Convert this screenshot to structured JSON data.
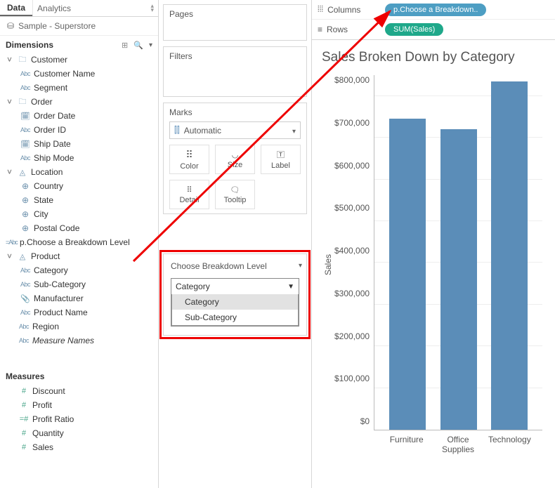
{
  "data_header": {
    "tab_data": "Data",
    "tab_analytics": "Analytics"
  },
  "datasource": "Sample - Superstore",
  "dimensions_header": "Dimensions",
  "measures_header": "Measures",
  "tree": {
    "customer": "Customer",
    "customer_name": "Customer Name",
    "segment": "Segment",
    "order": "Order",
    "order_date": "Order Date",
    "order_id": "Order ID",
    "ship_date": "Ship Date",
    "ship_mode": "Ship Mode",
    "location": "Location",
    "country": "Country",
    "state": "State",
    "city": "City",
    "postal_code": "Postal Code",
    "param_calc": "p.Choose a Breakdown Level",
    "product": "Product",
    "category": "Category",
    "sub_category": "Sub-Category",
    "manufacturer": "Manufacturer",
    "product_name": "Product Name",
    "region": "Region",
    "measure_names": "Measure Names"
  },
  "measures": {
    "discount": "Discount",
    "profit": "Profit",
    "profit_ratio": "Profit Ratio",
    "quantity": "Quantity",
    "sales": "Sales"
  },
  "cards": {
    "pages": "Pages",
    "filters": "Filters",
    "marks": "Marks",
    "mark_type": "Automatic",
    "color": "Color",
    "size": "Size",
    "label": "Label",
    "detail": "Detail",
    "tooltip": "Tooltip"
  },
  "param": {
    "title": "Choose Breakdown Level",
    "selected": "Category",
    "opt1": "Category",
    "opt2": "Sub-Category"
  },
  "shelves": {
    "columns": "Columns",
    "rows": "Rows",
    "col_pill": "p.Choose a Breakdown..",
    "row_pill": "SUM(Sales)"
  },
  "viz_title": "Sales Broken Down by Category",
  "axis_y_label": "Sales",
  "y_ticks": {
    "t0": "$800,000",
    "t1": "$700,000",
    "t2": "$600,000",
    "t3": "$500,000",
    "t4": "$400,000",
    "t5": "$300,000",
    "t6": "$200,000",
    "t7": "$100,000",
    "t8": "$0"
  },
  "x_ticks": {
    "c0": "Furniture",
    "c1": "Office Supplies",
    "c2": "Technology"
  },
  "chart_data": {
    "type": "bar",
    "title": "Sales Broken Down by Category",
    "xlabel": "",
    "ylabel": "Sales",
    "ylim": [
      0,
      850000
    ],
    "categories": [
      "Furniture",
      "Office Supplies",
      "Technology"
    ],
    "values": [
      745000,
      720000,
      835000
    ]
  }
}
